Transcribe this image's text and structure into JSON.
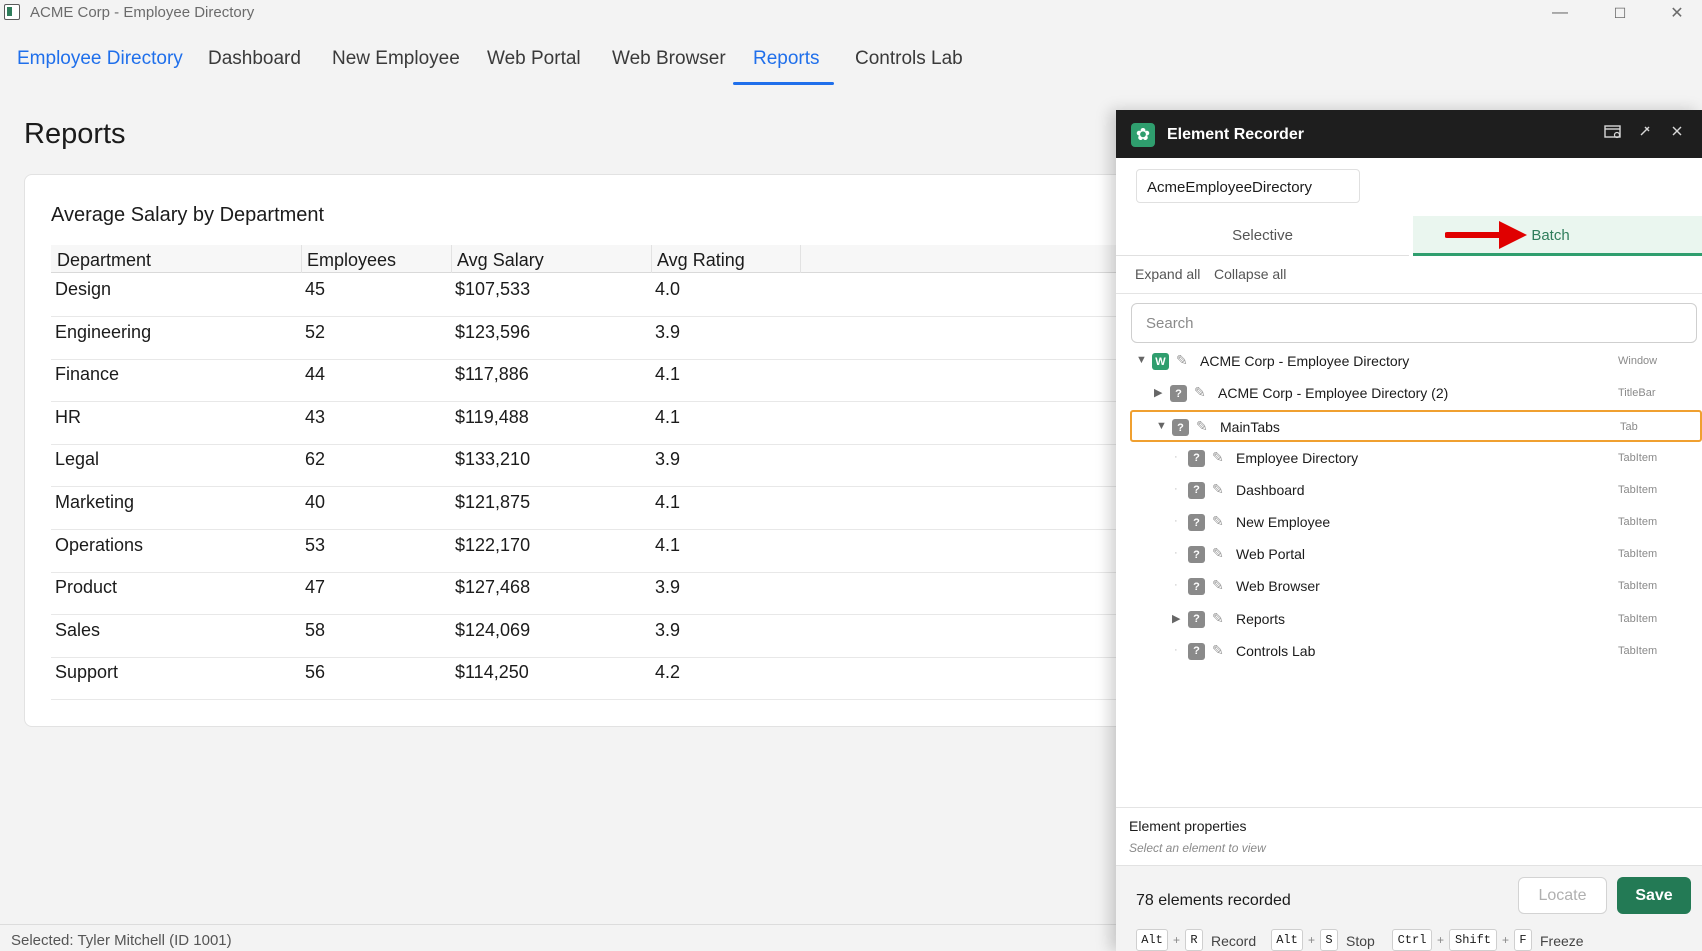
{
  "window": {
    "title": "ACME Corp - Employee Directory",
    "controls": {
      "minimize": "—",
      "maximize": "☐",
      "close": "✕"
    }
  },
  "tabs": [
    {
      "label": "Employee Directory"
    },
    {
      "label": "Dashboard"
    },
    {
      "label": "New Employee"
    },
    {
      "label": "Web Portal"
    },
    {
      "label": "Web Browser"
    },
    {
      "label": "Reports",
      "active": true
    },
    {
      "label": "Controls Lab"
    }
  ],
  "page": {
    "title": "Reports",
    "card_title": "Average Salary by Department",
    "columns": [
      "Department",
      "Employees",
      "Avg Salary",
      "Avg Rating"
    ],
    "rows": [
      [
        "Design",
        "45",
        "$107,533",
        "4.0"
      ],
      [
        "Engineering",
        "52",
        "$123,596",
        "3.9"
      ],
      [
        "Finance",
        "44",
        "$117,886",
        "4.1"
      ],
      [
        "HR",
        "43",
        "$119,488",
        "4.1"
      ],
      [
        "Legal",
        "62",
        "$133,210",
        "3.9"
      ],
      [
        "Marketing",
        "40",
        "$121,875",
        "4.1"
      ],
      [
        "Operations",
        "53",
        "$122,170",
        "4.1"
      ],
      [
        "Product",
        "47",
        "$127,468",
        "3.9"
      ],
      [
        "Sales",
        "58",
        "$124,069",
        "3.9"
      ],
      [
        "Support",
        "56",
        "$114,250",
        "4.2"
      ]
    ]
  },
  "status": {
    "text": "Selected: Tyler Mitchell (ID 1001)"
  },
  "recorder": {
    "title": "Element Recorder",
    "app_name": "AcmeEmployeeDirectory",
    "modes": {
      "selective": "Selective",
      "batch": "Batch"
    },
    "expand_all": "Expand all",
    "collapse_all": "Collapse all",
    "search_placeholder": "Search",
    "tree": [
      {
        "label": "ACME Corp - Employee Directory",
        "type": "Window",
        "badge": "W",
        "expanded": true
      },
      {
        "label": "ACME Corp - Employee Directory (2)",
        "type": "TitleBar",
        "badge": "?",
        "expanded": false
      },
      {
        "label": "MainTabs",
        "type": "Tab",
        "badge": "?",
        "expanded": true,
        "selected": true
      },
      {
        "label": "Employee Directory",
        "type": "TabItem",
        "badge": "?"
      },
      {
        "label": "Dashboard",
        "type": "TabItem",
        "badge": "?"
      },
      {
        "label": "New Employee",
        "type": "TabItem",
        "badge": "?"
      },
      {
        "label": "Web Portal",
        "type": "TabItem",
        "badge": "?"
      },
      {
        "label": "Web Browser",
        "type": "TabItem",
        "badge": "?"
      },
      {
        "label": "Reports",
        "type": "TabItem",
        "badge": "?",
        "expanded": false
      },
      {
        "label": "Controls Lab",
        "type": "TabItem",
        "badge": "?"
      }
    ],
    "props_title": "Element properties",
    "props_hint": "Select an element to view",
    "count_text": "78 elements recorded",
    "locate_label": "Locate",
    "save_label": "Save",
    "shortcuts": {
      "record": {
        "keys": [
          "Alt",
          "R"
        ],
        "label": "Record"
      },
      "stop": {
        "keys": [
          "Alt",
          "S"
        ],
        "label": "Stop"
      },
      "freeze": {
        "keys": [
          "Ctrl",
          "Shift",
          "F"
        ],
        "label": "Freeze"
      }
    }
  },
  "colors": {
    "accent": "#1f6feb",
    "recorder_green": "#2f9e6e",
    "save_green": "#237a55",
    "selection_orange": "#f0a030",
    "arrow_red": "#e00000"
  }
}
